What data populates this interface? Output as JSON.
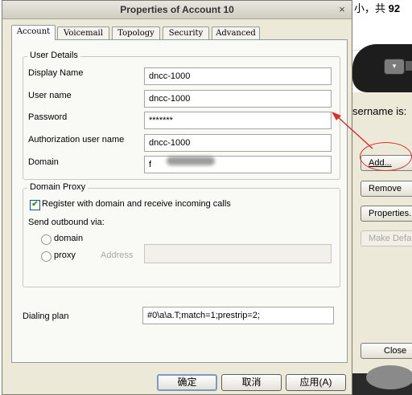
{
  "background": {
    "top_text": "小，共",
    "top_number": "92",
    "phone_button": "▾",
    "username_label": "sername is:",
    "buttons": {
      "add": "Add...",
      "remove": "Remove",
      "properties": "Properties.",
      "make_default": "Make Defau",
      "close": "Close"
    }
  },
  "dialog": {
    "title": "Properties of Account 10",
    "close_symbol": "×",
    "tabs": [
      "Account",
      "Voicemail",
      "Topology",
      "Security",
      "Advanced"
    ],
    "active_tab": "Account",
    "user_details": {
      "legend": "User Details",
      "display_name_label": "Display Name",
      "display_name_value": "dncc-1000",
      "user_name_label": "User name",
      "user_name_value": "dncc-1000",
      "password_label": "Password",
      "password_value": "*******",
      "auth_user_label": "Authorization user name",
      "auth_user_value": "dncc-1000",
      "domain_label": "Domain",
      "domain_value": "f"
    },
    "domain_proxy": {
      "legend": "Domain Proxy",
      "register_label": "Register with domain and receive incoming calls",
      "register_checked": true,
      "send_outbound_label": "Send outbound via:",
      "domain_option": "domain",
      "proxy_option": "proxy",
      "address_label": "Address",
      "address_value": ""
    },
    "dialing_plan_label": "Dialing plan",
    "dialing_plan_value": "#0\\a\\a.T;match=1;prestrip=2;",
    "buttons": {
      "ok": "确定",
      "cancel": "取消",
      "apply": "应用(A)"
    }
  },
  "colors": {
    "annotation": "#d93030",
    "dialog_bg": "#ece9d8"
  }
}
